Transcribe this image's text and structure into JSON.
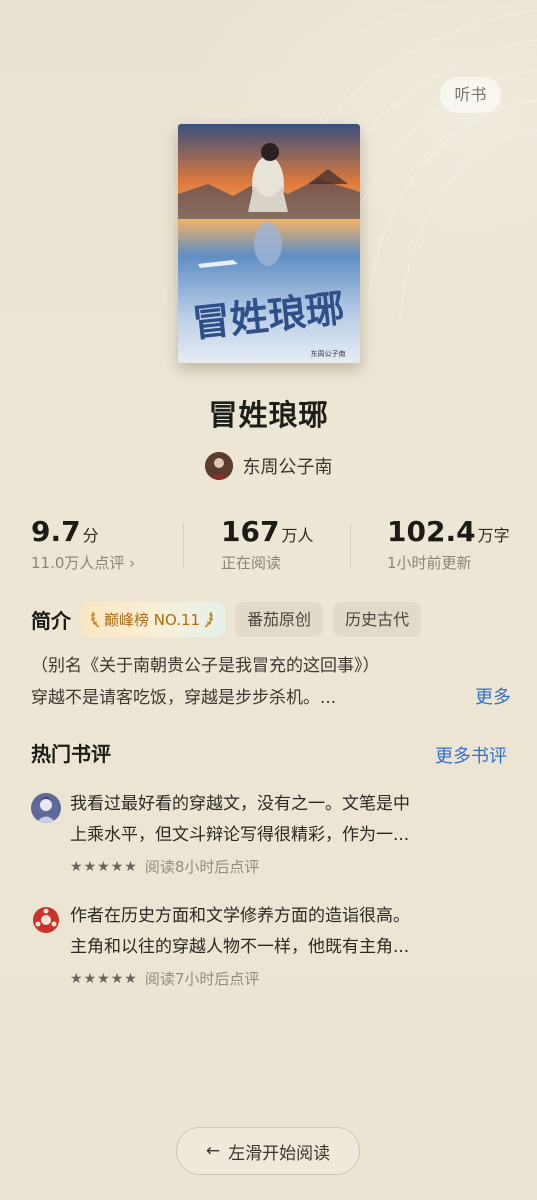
{
  "header": {
    "listen_label": "听书"
  },
  "book": {
    "cover_title": "冒姓琅琊",
    "cover_author": "东周公子南",
    "title": "冒姓琅琊",
    "author": "东周公子南"
  },
  "stats": [
    {
      "value": "9.7",
      "unit": "分",
      "sub": "11.0万人点评 ›"
    },
    {
      "value": "167",
      "unit": "万人",
      "sub": "正在阅读"
    },
    {
      "value": "102.4",
      "unit": "万字",
      "sub": "1小时前更新"
    }
  ],
  "intro": {
    "section_title": "简介",
    "rank_tag": "巅峰榜 NO.11",
    "tags": [
      "番茄原创",
      "历史古代"
    ],
    "lines": [
      "（别名《关于南朝贵公子是我冒充的这回事》）",
      "穿越不是请客吃饭，穿越是步步杀机。..."
    ],
    "more_label": "更多"
  },
  "reviews": {
    "section_title": "热门书评",
    "more_label": "更多书评",
    "items": [
      {
        "lines": [
          "我看过最好看的穿越文，没有之一。文笔是中",
          "上乘水平，但文斗辩论写得很精彩，作为一..."
        ],
        "meta": "阅读8小时后点评",
        "stars": 5
      },
      {
        "lines": [
          "作者在历史方面和文学修养方面的造诣很高。",
          "主角和以往的穿越人物不一样，他既有主角..."
        ],
        "meta": "阅读7小时后点评",
        "stars": 5
      }
    ]
  },
  "footer": {
    "start_reading_label": "左滑开始阅读",
    "arrow": "←"
  },
  "colors": {
    "background": "#ece5d4",
    "link": "#3570c8",
    "rank_text": "#b06b12"
  }
}
